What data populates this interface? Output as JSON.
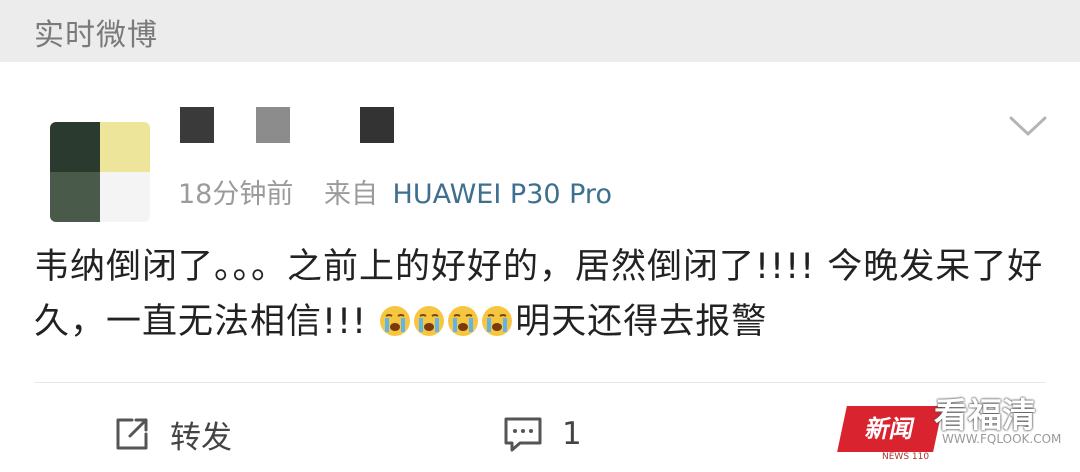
{
  "section": {
    "title": "实时微博"
  },
  "post": {
    "time": "18分钟前",
    "source_prefix": "来自",
    "source_device": "HUAWEI P30 Pro",
    "text_part1": "韦纳倒闭了。。。之前上的好好的，居然倒闭了!!!! 今晚发呆了好久，一直无法相信!!! ",
    "emoji": [
      "crying-emoji",
      "crying-emoji",
      "crying-emoji",
      "crying-emoji"
    ],
    "text_part2": "明天还得去报警"
  },
  "actions": {
    "repost_label": "转发",
    "comment_count": "1"
  },
  "watermark": {
    "logo_text": "新闻",
    "brand": "看福清",
    "url": "WWW.FQLOOK.COM",
    "sub": "NEWS 110"
  },
  "colors": {
    "header_bg": "#ececec",
    "device_link": "#3f6f8f",
    "watermark_red": "#d9232e"
  }
}
